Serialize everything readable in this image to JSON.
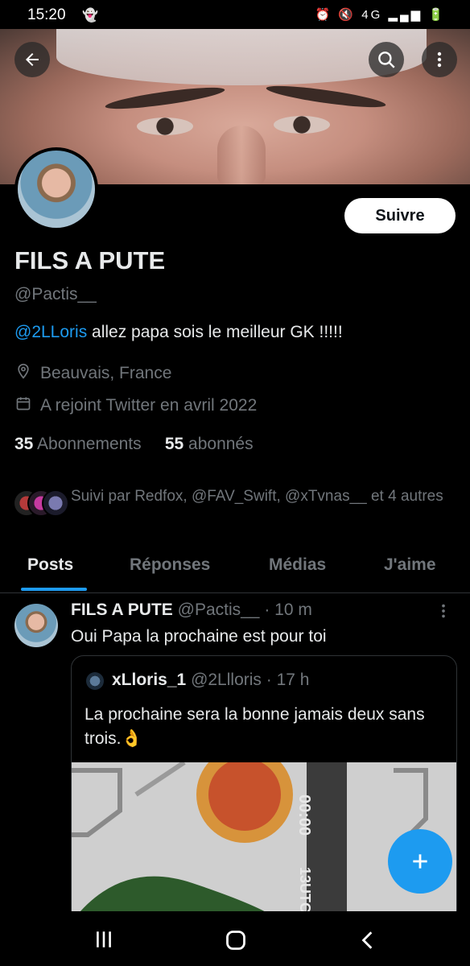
{
  "status_bar": {
    "time": "15:20",
    "network": "4G"
  },
  "profile": {
    "display_name": "FILS A PUTE",
    "handle": "@Pactis__",
    "bio_mention": "@2LLoris",
    "bio_text": " allez papa sois le meilleur GK !!!!!",
    "location": "Beauvais, France",
    "joined": "A rejoint Twitter en avril 2022",
    "following_count": "35",
    "following_label": "Abonnements",
    "followers_count": "55",
    "followers_label": "abonnés",
    "follow_button": "Suivre",
    "followed_by": "Suivi par Redfox, @FAV_Swift, @xTvnas__ et 4 autres"
  },
  "tabs": [
    {
      "label": "Posts",
      "active": true
    },
    {
      "label": "Réponses",
      "active": false
    },
    {
      "label": "Médias",
      "active": false
    },
    {
      "label": "J'aime",
      "active": false
    }
  ],
  "tweet": {
    "author_name": "FILS A PUTE",
    "author_handle": "@Pactis__",
    "time": "· 10 m",
    "text": "Oui Papa la prochaine est pour toi",
    "quote": {
      "author_name": "xLloris_1",
      "author_handle": "@2Llloris",
      "time": "· 17 h",
      "text": "La prochaine sera la bonne jamais deux sans trois.👌",
      "media_text_1": "00:00",
      "media_text_2": "13UTC"
    }
  },
  "colors": {
    "accent": "#1d9bf0",
    "background": "#000000",
    "secondary_text": "#71767b"
  },
  "icons": [
    "back-arrow-icon",
    "search-icon",
    "more-vertical-icon",
    "location-pin-icon",
    "calendar-icon",
    "compose-plus-icon",
    "recent-apps-icon",
    "home-icon",
    "nav-back-icon"
  ]
}
